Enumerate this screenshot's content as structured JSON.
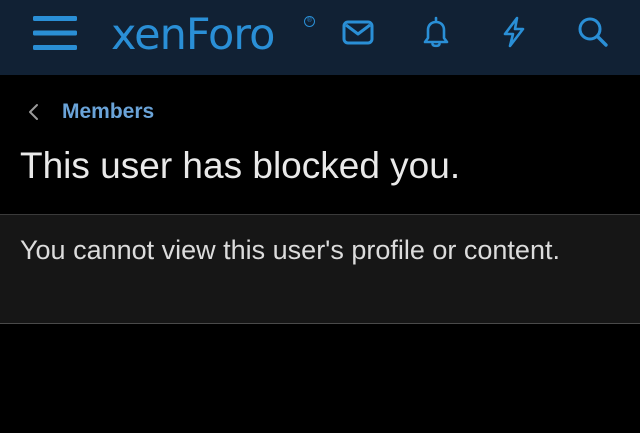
{
  "header": {
    "logo_text": "xenForo",
    "logo_mark": "®",
    "brand_color": "#2a8fd6",
    "background_color": "#112134",
    "icons": [
      "menu-icon",
      "inbox-icon",
      "bell-icon",
      "lightning-icon",
      "search-icon"
    ]
  },
  "breadcrumb": {
    "label": "Members"
  },
  "page": {
    "title": "This user has blocked you."
  },
  "message": {
    "text": "You cannot view this user's profile or content."
  }
}
